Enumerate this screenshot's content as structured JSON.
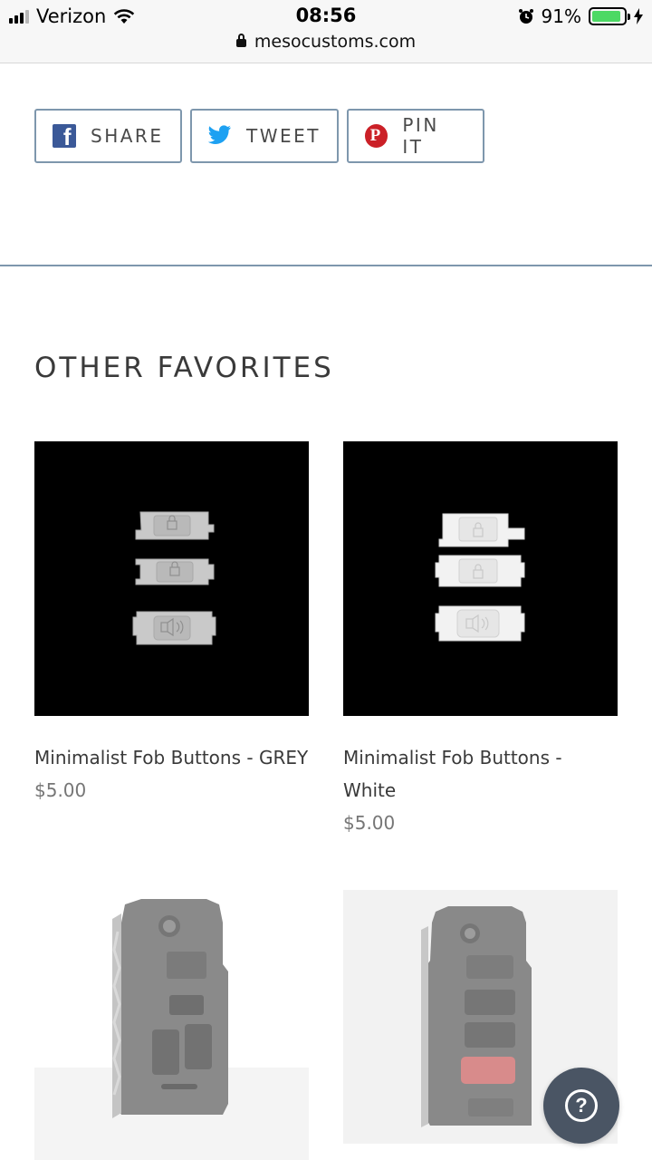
{
  "status_bar": {
    "carrier": "Verizon",
    "time": "08:56",
    "battery_percent": "91%",
    "battery_level": 0.91,
    "url": "mesocustoms.com"
  },
  "share": {
    "facebook_label": "SHARE",
    "twitter_label": "TWEET",
    "pinterest_label": "PIN IT"
  },
  "section_title": "OTHER FAVORITES",
  "products": [
    {
      "name": "Minimalist Fob Buttons - GREY",
      "price": "$5.00",
      "variant": "grey"
    },
    {
      "name": "Minimalist Fob Buttons - White",
      "price": "$5.00",
      "variant": "white"
    },
    {
      "name": "",
      "price": "",
      "variant": "fob-grey"
    },
    {
      "name": "",
      "price": "",
      "variant": "fob-red"
    }
  ],
  "colors": {
    "accent_border": "#7e97ad",
    "facebook": "#3b5998",
    "twitter": "#1da1f2",
    "pinterest": "#cb2027",
    "help_button": "#4a5564"
  }
}
